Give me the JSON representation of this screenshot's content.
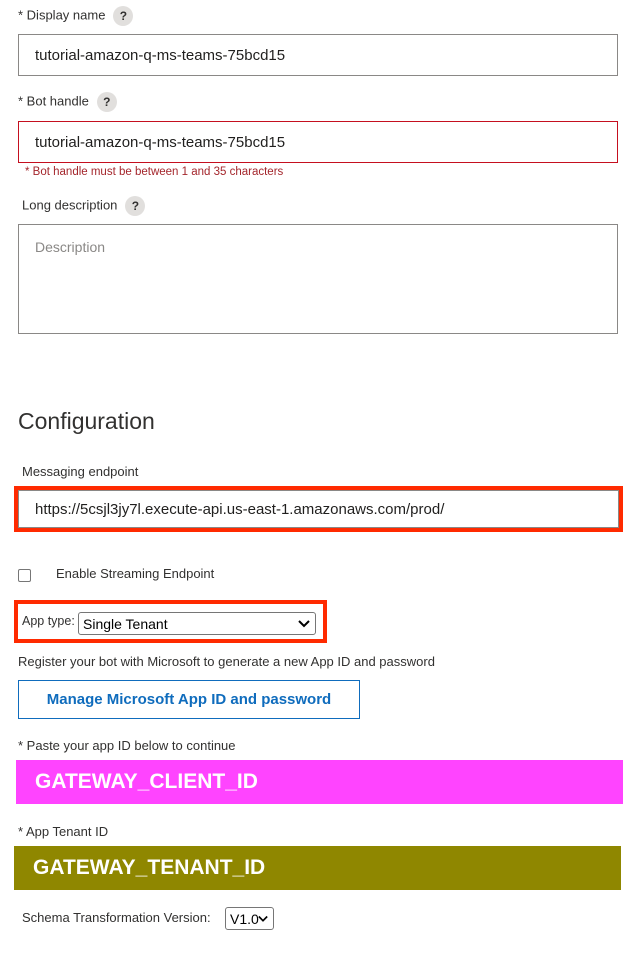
{
  "display_name": {
    "label": "* Display name",
    "help": "?",
    "value": "tutorial-amazon-q-ms-teams-75bcd15"
  },
  "bot_handle": {
    "label": "* Bot handle",
    "help": "?",
    "value": "tutorial-amazon-q-ms-teams-75bcd15",
    "error": "* Bot handle must be between 1 and 35 characters"
  },
  "long_description": {
    "label": "Long description",
    "help": "?",
    "placeholder": "Description"
  },
  "configuration": {
    "heading": "Configuration",
    "messaging_endpoint_label": "Messaging endpoint",
    "messaging_endpoint_value": "https://5csjl3jy7l.execute-api.us-east-1.amazonaws.com/prod/",
    "streaming_label": "Enable Streaming Endpoint",
    "streaming_checked": false,
    "app_type_label": "App type:",
    "app_type_value": "Single Tenant",
    "register_text": "Register your bot with Microsoft to generate a new App ID and password",
    "manage_button": "Manage Microsoft App ID and password",
    "app_id_label": "* Paste your app ID below to continue",
    "app_id_value": "GATEWAY_CLIENT_ID",
    "tenant_label": "* App Tenant ID",
    "tenant_value": "GATEWAY_TENANT_ID",
    "schema_label": "Schema Transformation Version:",
    "schema_value": "V1.0"
  },
  "colors": {
    "highlight_border": "#ff2a00",
    "client_id_bg": "#ff44ff",
    "tenant_id_bg": "#8f8700",
    "error": "#c50f1f",
    "primary": "#0f6cbd"
  }
}
